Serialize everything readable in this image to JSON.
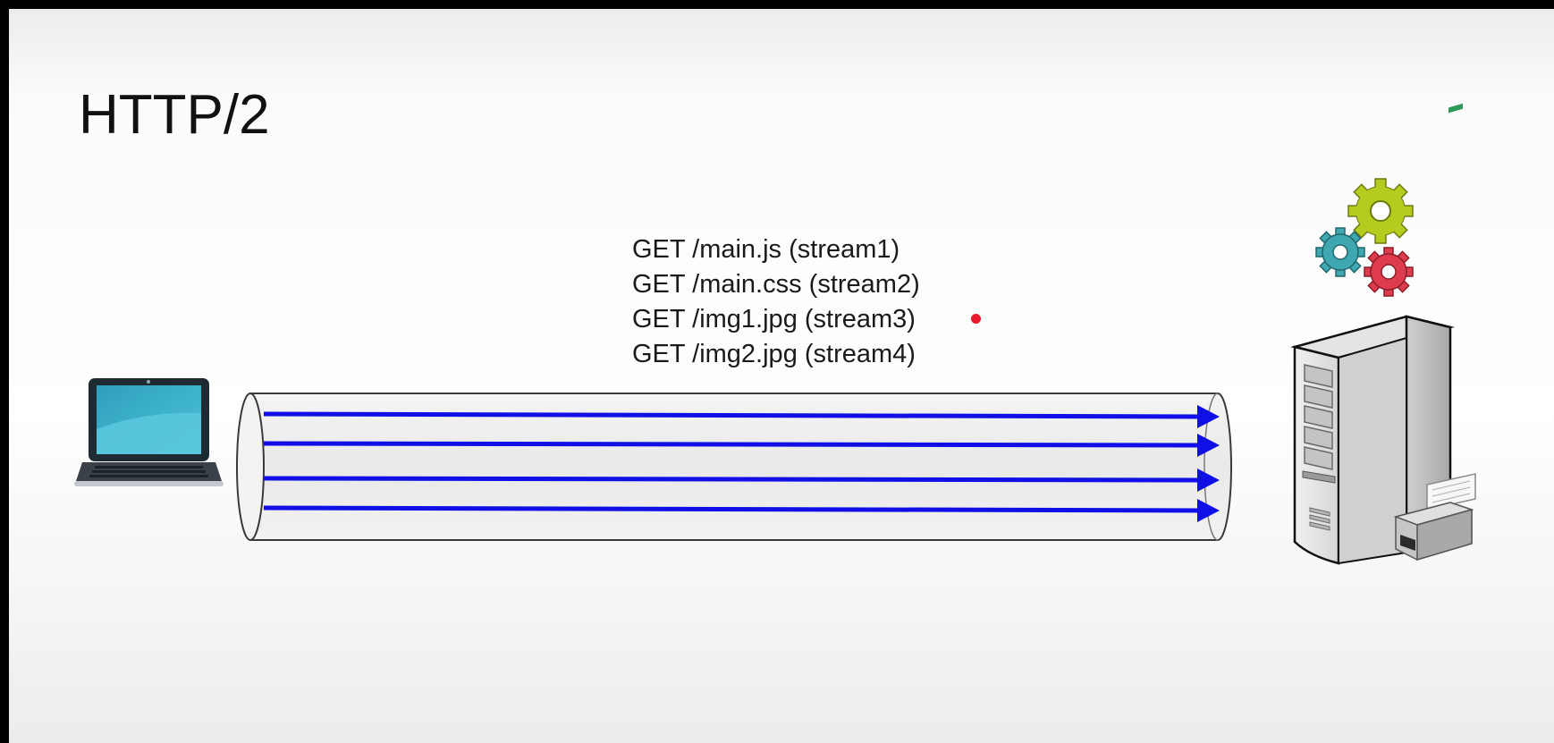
{
  "slide": {
    "title": "HTTP/2",
    "requests": [
      "GET /main.js (stream1)",
      "GET /main.css (stream2)",
      "GET /img1.jpg (stream3)",
      "GET /img2.jpg (stream4)"
    ]
  },
  "icons": {
    "client": "laptop-icon",
    "server": "server-tower-icon",
    "printer": "printer-icon",
    "gears": "gears-icon"
  },
  "colors": {
    "stream_arrow": "#1010e6",
    "gear_green": "#b5cc1e",
    "gear_teal": "#3ea7b0",
    "gear_red": "#de3b4f",
    "laptop_screen": "#2aa2be",
    "pointer_dot": "#e8192c"
  }
}
